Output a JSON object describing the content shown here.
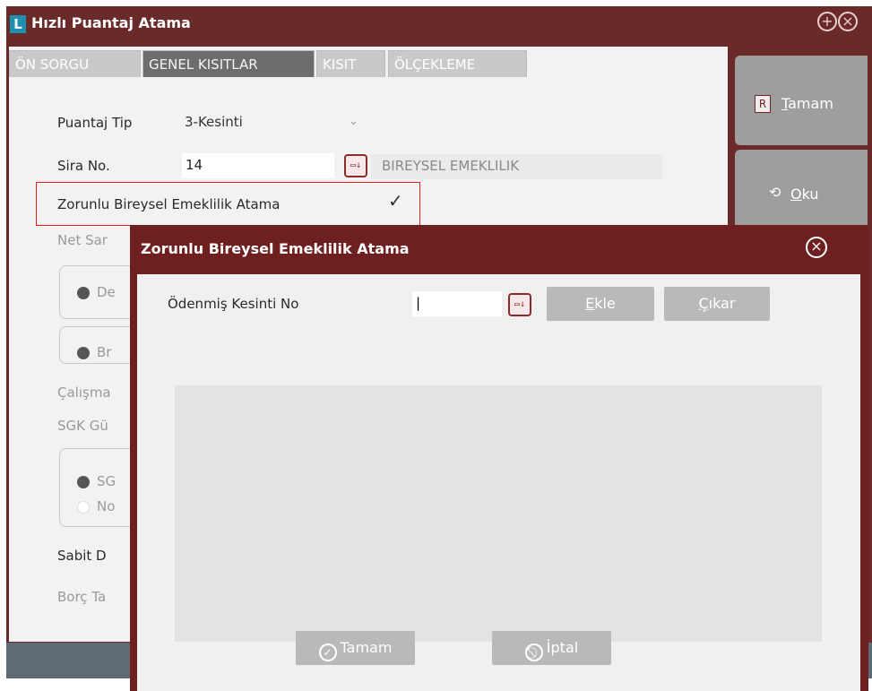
{
  "window": {
    "title": "Hızlı Puantaj Atama",
    "logo_letter": "L",
    "title_icons": [
      "plus-circle-icon",
      "close-circle-icon"
    ]
  },
  "tabs": [
    {
      "label": "ÖN SORGU",
      "active": false
    },
    {
      "label": "GENEL KISITLAR",
      "active": true
    },
    {
      "label": "KISIT",
      "active": false
    },
    {
      "label": "ÖLÇEKLEME",
      "active": false
    }
  ],
  "form": {
    "puantaj_tip_label": "Puantaj Tip",
    "puantaj_tip_value": "3-Kesinti",
    "sira_no_label": "Sira No.",
    "sira_no_value": "14",
    "sira_no_description": "BIREYSEL EMEKLILIK",
    "zorunlu_label": "Zorunlu Bireysel Emeklilik Atama",
    "zorunlu_checked": true,
    "net_label": "Net Sar",
    "radio1_label": "De",
    "radio2_label": "Br",
    "calisma_label": "Çalışma",
    "sgk_label": "SGK Gü",
    "radio_sg_label": "SG",
    "radio_no_label": "No",
    "sabit_label": "Sabit D",
    "borc_label": "Borç Ta"
  },
  "side_buttons": {
    "tamam": "Tamam",
    "oku": "Oku",
    "tamam_icon": "R",
    "partial_text": "n"
  },
  "dialog": {
    "title": "Zorunlu Bireysel Emeklilik  Atama",
    "odenmis_label": "Ödenmiş Kesinti No",
    "odenmis_value": "|",
    "ekle": "Ekle",
    "cikar": "Çıkar",
    "tamam": "Tamam",
    "iptal": "İptal"
  },
  "colors": {
    "title_bar": "#6b2a2a",
    "dialog_frame": "#6e2020",
    "highlight_border": "#e81c1c",
    "button_gray": "#b9b9b9"
  }
}
